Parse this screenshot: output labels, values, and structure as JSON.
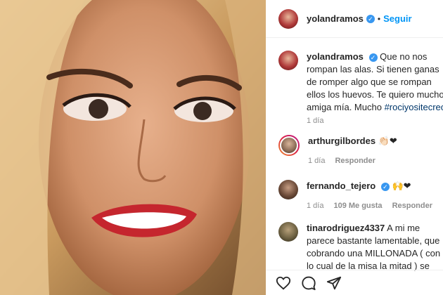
{
  "header": {
    "username": "yolandramos",
    "verified_mark": "✓",
    "separator": "•",
    "follow_label": "Seguir"
  },
  "caption": {
    "username": "yolandramos",
    "text": "Que no nos rompan las alas. Si tienen ganas de romper algo que se rompan ellos los huevos. Te quiero mucho amiga mía. Mucho",
    "hashtag": "#rociyositecreo",
    "time": "1 día"
  },
  "comments": [
    {
      "username": "arthurgilbordes",
      "text": "👏🏻❤",
      "time": "1 día",
      "reply_label": "Responder"
    },
    {
      "username": "fernando_tejero",
      "text": "🙌❤",
      "time": "1 día",
      "likes": "109 Me gusta",
      "reply_label": "Responder"
    },
    {
      "username": "tinarodriguez4337",
      "text": "A mi me parece bastante lamentable, que cobrando una MILLONADA ( con lo cual de la misa la mitad ) se"
    }
  ],
  "icons": [
    "heart-icon",
    "comment-icon",
    "share-icon"
  ],
  "colors": {
    "link": "#0095f6",
    "verified": "#3897f0",
    "hashtag": "#00376b",
    "meta": "#8e8e8e"
  }
}
